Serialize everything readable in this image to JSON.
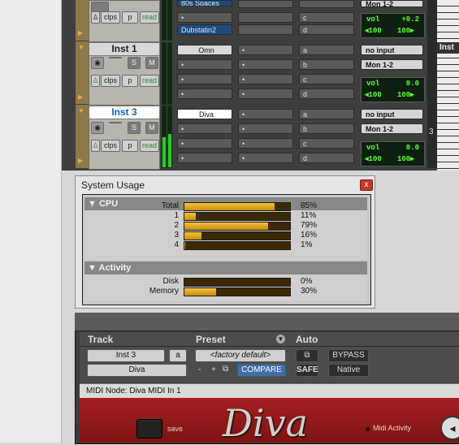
{
  "mixer": {
    "tracks": [
      {
        "name": "",
        "inserts": [
          "80s Spaces",
          "Dubstatin2"
        ],
        "sends": [
          "a",
          "b",
          "c",
          "d"
        ],
        "input": "",
        "output": "Mon 1-2",
        "vol": "+0.2",
        "pan_l": "100",
        "pan_r": "100"
      },
      {
        "name": "Inst 1",
        "inserts": [
          "Omn"
        ],
        "sends": [
          "a",
          "b",
          "c",
          "d"
        ],
        "input": "no input",
        "output": "Mon 1-2",
        "vol": "0.0",
        "pan_l": "100",
        "pan_r": "100"
      },
      {
        "name": "Inst 3",
        "inserts": [
          "Diva"
        ],
        "sends": [
          "a",
          "b",
          "c",
          "d"
        ],
        "input": "no input",
        "output": "Mon 1-2",
        "vol": "0.0",
        "pan_l": "100",
        "pan_r": "100"
      }
    ],
    "buttons": {
      "s": "S",
      "m": "M",
      "clps": "clps",
      "p": "p",
      "read": "read",
      "vol": "vol",
      "pan_prefix": "◂"
    },
    "right_label": "Inst",
    "right_num": "3"
  },
  "system_usage": {
    "title": "System Usage",
    "close": "x",
    "cpu_header": "CPU",
    "cpu": [
      {
        "label": "Total",
        "pct": "85%",
        "value": 85
      },
      {
        "label": "1",
        "pct": "11%",
        "value": 11
      },
      {
        "label": "2",
        "pct": "79%",
        "value": 79
      },
      {
        "label": "3",
        "pct": "16%",
        "value": 16
      },
      {
        "label": "4",
        "pct": "1%",
        "value": 1
      }
    ],
    "activity_header": "Activity",
    "activity": [
      {
        "label": "Disk",
        "pct": "0%",
        "value": 0
      },
      {
        "label": "Memory",
        "pct": "30%",
        "value": 30
      }
    ]
  },
  "plugin": {
    "track_label": "Track",
    "preset_label": "Preset",
    "auto_label": "Auto",
    "track_name": "Inst 3",
    "track_sub": "a",
    "plugin_name": "Diva",
    "preset_value": "<factory default>",
    "minus": "-",
    "plus": "+",
    "compare": "COMPARE",
    "safe": "SAFE",
    "bypass": "BYPASS",
    "native": "Native",
    "midi_node": "MIDI Node: Diva MIDI In 1",
    "save": "save",
    "logo": "Diva",
    "midi_activity": "Midi Activity"
  },
  "colors": {
    "accent": "#f0b41c",
    "meter": "#21d321",
    "diva_red": "#a3201f"
  }
}
